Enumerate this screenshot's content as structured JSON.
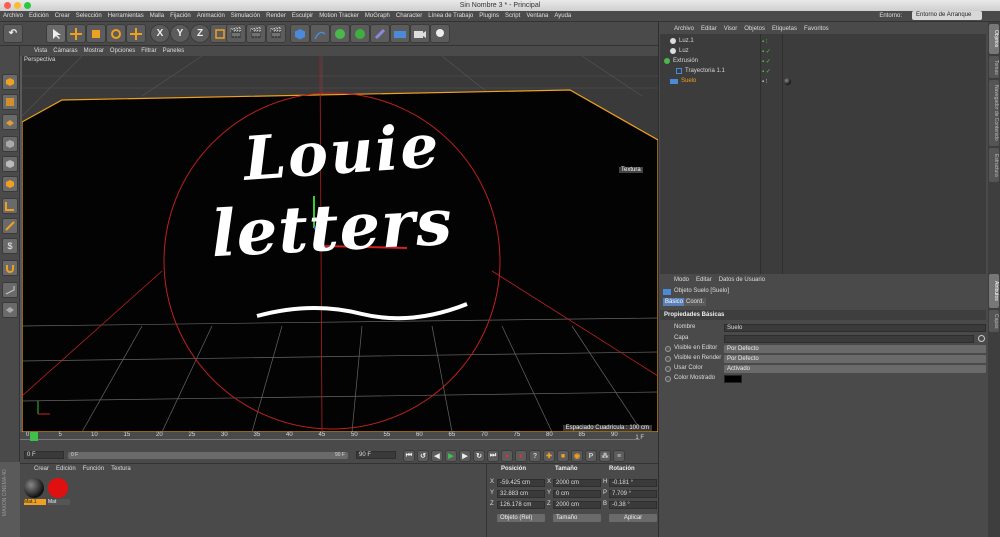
{
  "window": {
    "title": "Sin Nombre 3 * - Principal"
  },
  "menubar": {
    "items": [
      "Archivo",
      "Edición",
      "Crear",
      "Selección",
      "Herramientas",
      "Malla",
      "Fijación",
      "Animación",
      "Simulación",
      "Render",
      "Esculpir",
      "Motion Tracker",
      "MoGraph",
      "Character",
      "Línea de Trabajo",
      "Plugins",
      "Script",
      "Ventana",
      "Ayuda"
    ],
    "env_label": "Entorno:",
    "env_value": "Entorno de Arranque"
  },
  "toolbar": {
    "x_label": "X",
    "y_label": "Y",
    "z_label": "Z"
  },
  "viewport": {
    "menu": [
      "Vista",
      "Cámaras",
      "Mostrar",
      "Opciones",
      "Filtrar",
      "Paneles"
    ],
    "camera_label": "Perspectiva",
    "texture_tag": "Textura",
    "grid_spacing": "Espaciado Cuadrícula : 100 cm",
    "artwork_line1": "Louie",
    "artwork_line2": "letters"
  },
  "timeline": {
    "ticks": [
      "0",
      "5",
      "10",
      "15",
      "20",
      "25",
      "30",
      "35",
      "40",
      "45",
      "50",
      "55",
      "60",
      "65",
      "70",
      "75",
      "80",
      "85",
      "90"
    ],
    "current_frame": "1 F",
    "start_field": "0 F",
    "range_start": "0 F",
    "range_end": "90 F",
    "end_field": "90 F"
  },
  "materials": {
    "menu": [
      "Crear",
      "Edición",
      "Función",
      "Textura"
    ],
    "items": [
      {
        "name": "Mat.1",
        "color": "#2a2a2a"
      },
      {
        "name": "Mat",
        "color": "#e01010"
      }
    ],
    "brand": "MAXON CINEMA 4D"
  },
  "coords": {
    "headers": [
      "Posición",
      "Tamaño",
      "Rotación"
    ],
    "rows": [
      {
        "axis": "X",
        "pos": "-59.425 cm",
        "size_axis": "X",
        "size": "2000 cm",
        "rot_axis": "H",
        "rot": "-0.181 °"
      },
      {
        "axis": "Y",
        "pos": "32.883 cm",
        "size_axis": "Y",
        "size": "0 cm",
        "rot_axis": "P",
        "rot": "7.709 °"
      },
      {
        "axis": "Z",
        "pos": "126.178 cm",
        "size_axis": "Z",
        "size": "2000 cm",
        "rot_axis": "B",
        "rot": "-0.38 °"
      }
    ],
    "mode_select": "Objeto (Rel)",
    "size_select": "Tamaño",
    "apply_label": "Aplicar"
  },
  "object_manager": {
    "menu": [
      "Archivo",
      "Editar",
      "Visor",
      "Objetos",
      "Etiquetas",
      "Favoritos"
    ],
    "objects": [
      {
        "name": "Luz.1",
        "indent": 0,
        "selected": false
      },
      {
        "name": "Luz",
        "indent": 0,
        "selected": false
      },
      {
        "name": "Extrusión",
        "indent": 0,
        "selected": false
      },
      {
        "name": "Trayectoria 1.1",
        "indent": 1,
        "selected": false
      },
      {
        "name": "Suelo",
        "indent": 0,
        "selected": true
      }
    ]
  },
  "attribute_manager": {
    "menu": [
      "Modo",
      "Editar",
      "Datos de Usuario"
    ],
    "object_title": "Objeto Suelo [Suelo]",
    "tabs": [
      "Básico",
      "Coord."
    ],
    "section": "Propiedades Básicas",
    "fields": [
      {
        "label": "Nombre",
        "value": "Suelo"
      },
      {
        "label": "Capa",
        "value": ""
      },
      {
        "label": "Visible en Editor",
        "value": "Por Defecto"
      },
      {
        "label": "Visible en Render",
        "value": "Por Defecto"
      },
      {
        "label": "Usar Color",
        "value": "Activado"
      },
      {
        "label": "Color Mostrado",
        "value": ""
      }
    ]
  },
  "side_tabs": [
    "Objetos",
    "Tomas",
    "Navegador de Contenido",
    "Estructura",
    "Atributos",
    "Capas"
  ],
  "colors": {
    "accent": "#f0a020",
    "selected_row": "#f0a020",
    "panel": "#4a4a4a"
  }
}
